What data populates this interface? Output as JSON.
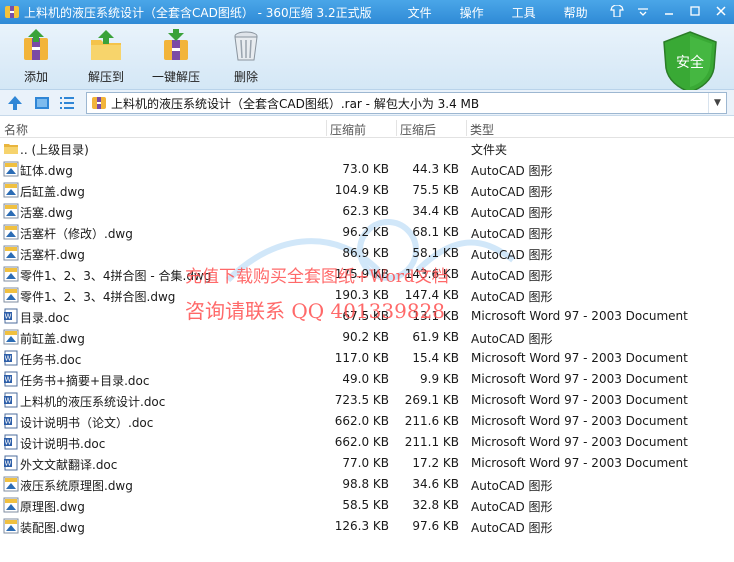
{
  "window": {
    "title": "上料机的液压系统设计（全套含CAD图纸） - 360压缩 3.2正式版",
    "menu": [
      "文件",
      "操作",
      "工具",
      "帮助"
    ]
  },
  "toolbar": {
    "items": [
      {
        "label": "添加",
        "icon": "add-archive-icon"
      },
      {
        "label": "解压到",
        "icon": "extract-folder-icon"
      },
      {
        "label": "一键解压",
        "icon": "one-click-extract-icon"
      },
      {
        "label": "删除",
        "icon": "trash-bin-icon"
      }
    ],
    "security_badge": "安全"
  },
  "address": {
    "path": "上料机的液压系统设计（全套含CAD图纸）.rar - 解包大小为 3.4 MB"
  },
  "columns": {
    "name": "名称",
    "size": "压缩前",
    "packed": "压缩后",
    "type": "类型"
  },
  "files": [
    {
      "name": ".. (上级目录)",
      "size": "",
      "packed": "",
      "type": "文件夹",
      "kind": "folder"
    },
    {
      "name": "缸体.dwg",
      "size": "73.0 KB",
      "packed": "44.3 KB",
      "type": "AutoCAD 图形",
      "kind": "dwg"
    },
    {
      "name": "后缸盖.dwg",
      "size": "104.9 KB",
      "packed": "75.5 KB",
      "type": "AutoCAD 图形",
      "kind": "dwg"
    },
    {
      "name": "活塞.dwg",
      "size": "62.3 KB",
      "packed": "34.4 KB",
      "type": "AutoCAD 图形",
      "kind": "dwg"
    },
    {
      "name": "活塞杆（修改）.dwg",
      "size": "96.2 KB",
      "packed": "68.1 KB",
      "type": "AutoCAD 图形",
      "kind": "dwg"
    },
    {
      "name": "活塞杆.dwg",
      "size": "86.9 KB",
      "packed": "58.1 KB",
      "type": "AutoCAD 图形",
      "kind": "dwg"
    },
    {
      "name": "零件1、2、3、4拼合图 - 合集.dwg",
      "size": "175.9 KB",
      "packed": "143.6 KB",
      "type": "AutoCAD 图形",
      "kind": "dwg"
    },
    {
      "name": "零件1、2、3、4拼合图.dwg",
      "size": "190.3 KB",
      "packed": "147.4 KB",
      "type": "AutoCAD 图形",
      "kind": "dwg"
    },
    {
      "name": "目录.doc",
      "size": "67.5 KB",
      "packed": "13.1 KB",
      "type": "Microsoft Word 97 - 2003 Document",
      "kind": "doc"
    },
    {
      "name": "前缸盖.dwg",
      "size": "90.2 KB",
      "packed": "61.9 KB",
      "type": "AutoCAD 图形",
      "kind": "dwg"
    },
    {
      "name": "任务书.doc",
      "size": "117.0 KB",
      "packed": "15.4 KB",
      "type": "Microsoft Word 97 - 2003 Document",
      "kind": "doc"
    },
    {
      "name": "任务书+摘要+目录.doc",
      "size": "49.0 KB",
      "packed": "9.9 KB",
      "type": "Microsoft Word 97 - 2003 Document",
      "kind": "doc"
    },
    {
      "name": "上料机的液压系统设计.doc",
      "size": "723.5 KB",
      "packed": "269.1 KB",
      "type": "Microsoft Word 97 - 2003 Document",
      "kind": "doc"
    },
    {
      "name": "设计说明书（论文）.doc",
      "size": "662.0 KB",
      "packed": "211.6 KB",
      "type": "Microsoft Word 97 - 2003 Document",
      "kind": "doc"
    },
    {
      "name": "设计说明书.doc",
      "size": "662.0 KB",
      "packed": "211.1 KB",
      "type": "Microsoft Word 97 - 2003 Document",
      "kind": "doc"
    },
    {
      "name": "外文文献翻译.doc",
      "size": "77.0 KB",
      "packed": "17.2 KB",
      "type": "Microsoft Word 97 - 2003 Document",
      "kind": "doc"
    },
    {
      "name": "液压系统原理图.dwg",
      "size": "98.8 KB",
      "packed": "34.6 KB",
      "type": "AutoCAD 图形",
      "kind": "dwg"
    },
    {
      "name": "原理图.dwg",
      "size": "58.5 KB",
      "packed": "32.8 KB",
      "type": "AutoCAD 图形",
      "kind": "dwg"
    },
    {
      "name": "装配图.dwg",
      "size": "126.3 KB",
      "packed": "97.6 KB",
      "type": "AutoCAD 图形",
      "kind": "dwg"
    }
  ],
  "watermark": {
    "line1": "充值下载购买全套图纸+Word文档",
    "line2": "咨询请联系  QQ 401339828"
  }
}
